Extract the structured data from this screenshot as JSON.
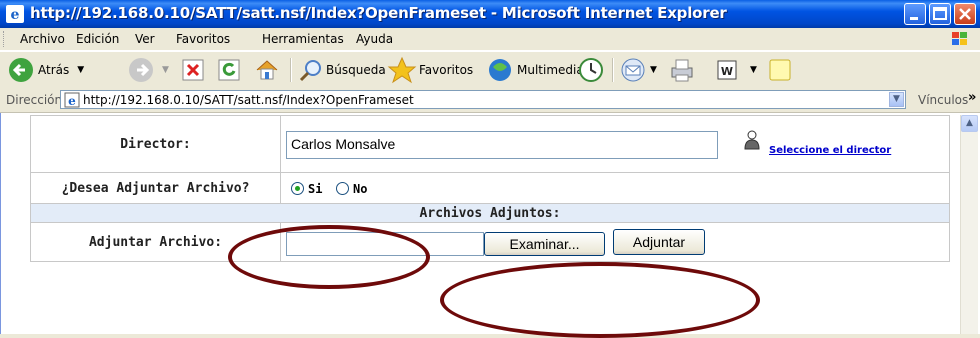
{
  "window": {
    "title": "http://192.168.0.10/SATT/satt.nsf/Index?OpenFrameset - Microsoft Internet Explorer"
  },
  "menu": {
    "items": [
      "Archivo",
      "Edición",
      "Ver",
      "Favoritos",
      "Herramientas",
      "Ayuda"
    ]
  },
  "toolbar": {
    "back_label": "Atrás",
    "search_label": "Búsqueda",
    "favorites_label": "Favoritos",
    "media_label": "Multimedia"
  },
  "address": {
    "label": "Dirección",
    "url": "http://192.168.0.10/SATT/satt.nsf/Index?OpenFrameset",
    "links_label": "Vínculos",
    "more": "»"
  },
  "form": {
    "director_label": "Director:",
    "director_value": "Carlos Monsalve",
    "select_director_link": "Seleccione el director",
    "attach_question": "¿Desea Adjuntar Archivo?",
    "radio_si": "Si",
    "radio_no": "No",
    "radio_selected": "Si",
    "attached_files_header": "Archivos Adjuntos:",
    "attach_file_label": "Adjuntar Archivo:",
    "attach_file_value": "",
    "browse_button": "Examinar...",
    "attach_button": "Adjuntar"
  },
  "colors": {
    "titlebar": "#0054e3",
    "annotation": "#6e0a0a",
    "section_header_bg": "#e3ecf8"
  }
}
